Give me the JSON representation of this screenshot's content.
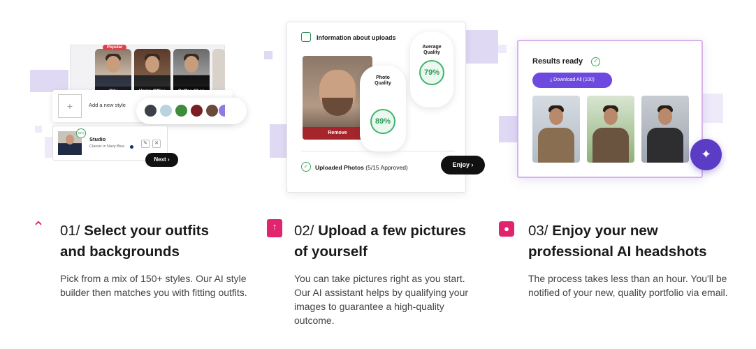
{
  "card1": {
    "popular_badge": "Popular",
    "photos": [
      "City",
      "Home Office",
      "Coffee Shop"
    ],
    "add_style_label": "Add a new style",
    "swatches": [
      "#3c4149",
      "#b9d4df",
      "#3f8a3b",
      "#7b1e24",
      "#6a4a3a",
      "#8f7be0"
    ],
    "studio_title": "Studio",
    "studio_subtitle": "Classic in Navy Blue",
    "studio_pct": "93%",
    "next_label": "Next ›"
  },
  "card2": {
    "header": "Information about uploads",
    "photo_quality_label": "Photo Quality",
    "photo_quality_value": "89%",
    "average_quality_label": "Average Quality",
    "average_quality_value": "79%",
    "remove_label": "Remove",
    "uploaded_label": "Uploaded Photos",
    "uploaded_count": "(5/15 Approved)",
    "enjoy_label": "Enjoy ›"
  },
  "card3": {
    "title": "Results ready",
    "download_label": "⤓ Download All (100)"
  },
  "steps": [
    {
      "num": "01/",
      "title_line1": "Select your outfits",
      "title_line2": "and backgrounds",
      "desc": "Pick from a mix of 150+ styles. Our AI style builder then matches you with fitting outfits."
    },
    {
      "num": "02/",
      "title_line1": "Upload a few pictures",
      "title_line2": "of yourself",
      "desc": "You can take pictures right as you start. Our AI assistant helps by qualifying your images to guarantee a high-quality outcome."
    },
    {
      "num": "03/",
      "title_line1": "Enjoy your new",
      "title_line2": "professional AI headshots",
      "desc": "The process takes less than an hour. You'll be notified of your new, quality portfolio via email."
    }
  ]
}
